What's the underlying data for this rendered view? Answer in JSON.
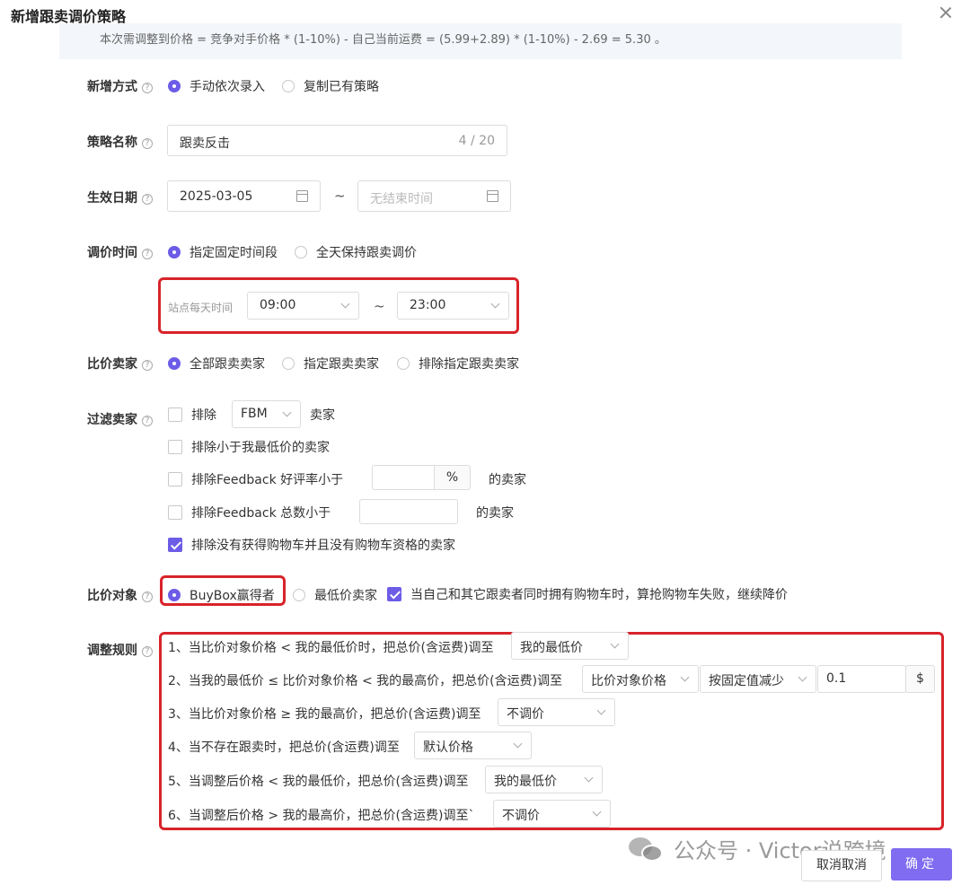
{
  "dialog": {
    "title": "新增跟卖调价策略"
  },
  "hint": {
    "text": "本次需调整到价格 = 竞争对手价格 * (1-10%) - 自己当前运费 = (5.99+2.89) * (1-10%) - 2.69 = 5.30 。"
  },
  "add_mode": {
    "label": "新增方式",
    "options": [
      "手动依次录入",
      "复制已有策略"
    ],
    "selected": 0
  },
  "strategy_name": {
    "label": "策略名称",
    "value": "跟卖反击",
    "counter": "4 / 20"
  },
  "effective_date": {
    "label": "生效日期",
    "start": "2025-03-05",
    "separator": "~",
    "end_placeholder": "无结束时间"
  },
  "adjust_time": {
    "label": "调价时间",
    "options": [
      "指定固定时间段",
      "全天保持跟卖调价"
    ],
    "selected": 0,
    "site_time_label": "站点每天时间",
    "start": "09:00",
    "separator": "~",
    "end": "23:00"
  },
  "compare_seller": {
    "label": "比价卖家",
    "options": [
      "全部跟卖卖家",
      "指定跟卖卖家",
      "排除指定跟卖卖家"
    ],
    "selected": 0
  },
  "filter_seller": {
    "label": "过滤卖家",
    "exclude_label": "排除",
    "fbm_value": "FBM",
    "seller_suffix": "卖家",
    "exclude_lowest": "排除小于我最低价的卖家",
    "exclude_feedback_rate": "排除Feedback 好评率小于",
    "percent": "%",
    "rate_suffix": "的卖家",
    "exclude_feedback_total": "排除Feedback 总数小于",
    "total_suffix": "的卖家",
    "exclude_no_buybox": "排除没有获得购物车并且没有购物车资格的卖家",
    "checked": [
      false,
      false,
      false,
      false,
      true
    ]
  },
  "compare_target": {
    "label": "比价对象",
    "options": [
      "BuyBox赢得者",
      "最低价卖家"
    ],
    "selected": 0,
    "continue_label": "当自己和其它跟卖者同时拥有购物车时，算抢购物车失败，继续降价",
    "continue_checked": true
  },
  "rules": {
    "label": "调整规则",
    "r1": {
      "text": "1、当比价对象价格 < 我的最低价时，把总价(含运费)调至",
      "select": "我的最低价"
    },
    "r2": {
      "text": "2、当我的最低价 ≤ 比价对象价格 < 我的最高价，把总价(含运费)调至",
      "select": "比价对象价格",
      "mode": "按固定值减少",
      "amount": "0.1",
      "unit": "$"
    },
    "r3": {
      "text": "3、当比价对象价格 ≥ 我的最高价，把总价(含运费)调至",
      "select": "不调价"
    },
    "r4": {
      "text": "4、当不存在跟卖时，把总价(含运费)调至",
      "select": "默认价格"
    },
    "r5": {
      "text": "5、当调整后价格 < 我的最低价，把总价(含运费)调至",
      "select": "我的最低价"
    },
    "r6": {
      "text": "6、当调整后价格 > 我的最高价，把总价(含运费)调至`",
      "select": "不调价"
    }
  },
  "footer": {
    "cancel": "取消取消",
    "ok": "确定"
  },
  "watermark": {
    "text": "公众号 · Victor说跨境"
  }
}
